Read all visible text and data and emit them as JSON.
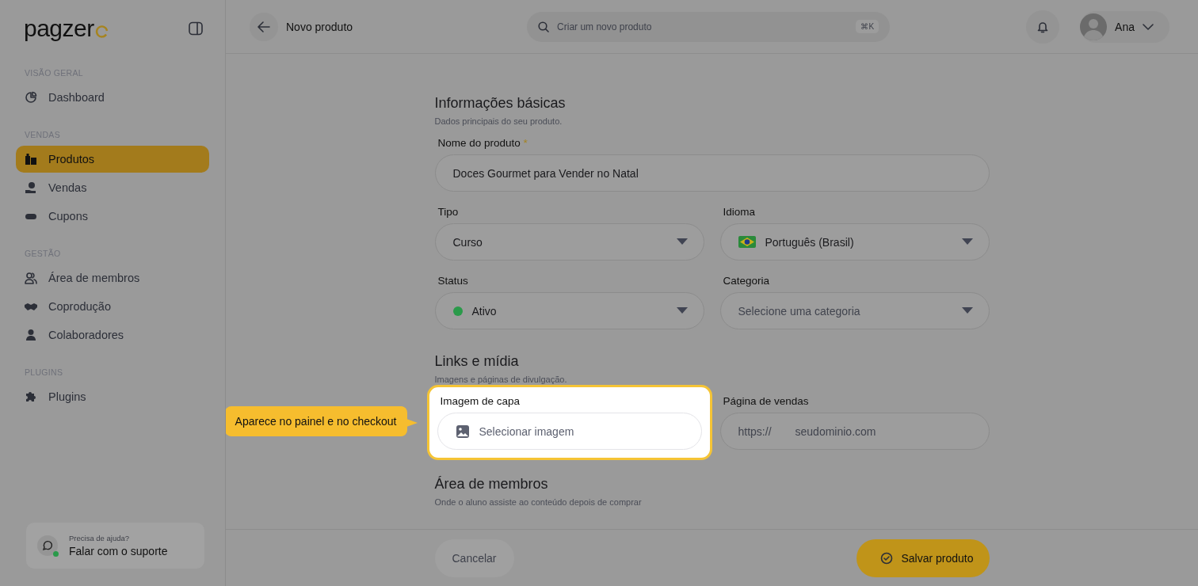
{
  "sidebar": {
    "logo": "pagzer",
    "sections": [
      {
        "heading": "VISÃO GERAL",
        "items": [
          {
            "label": "Dashboard",
            "selected": false
          }
        ]
      },
      {
        "heading": "VENDAS",
        "items": [
          {
            "label": "Produtos",
            "selected": true
          },
          {
            "label": "Vendas",
            "selected": false
          },
          {
            "label": "Cupons",
            "selected": false
          }
        ]
      },
      {
        "heading": "GESTÃO",
        "items": [
          {
            "label": "Área de membros",
            "selected": false
          },
          {
            "label": "Coprodução",
            "selected": false
          },
          {
            "label": "Colaboradores",
            "selected": false
          }
        ]
      },
      {
        "heading": "PLUGINS",
        "items": [
          {
            "label": "Plugins",
            "selected": false
          }
        ]
      }
    ],
    "help": {
      "caption": "Precisa de ajuda?",
      "link": "Falar com o suporte",
      "online": true
    }
  },
  "header": {
    "title": "Novo produto",
    "search": {
      "placeholder": "Criar um novo produto",
      "shortcut": "⌘K"
    },
    "user": "Ana"
  },
  "sections": [
    {
      "title": "Informações básicas",
      "subtitle": "Dados principais do seu produto.",
      "fields": [
        {
          "kind": "text",
          "label": "Nome do produto",
          "required_mark": "*",
          "value": "Doces Gourmet para Vender no Natal"
        },
        {
          "kind": "select",
          "label": "Tipo",
          "value": "Curso"
        },
        {
          "kind": "language",
          "label": "Idioma",
          "value": "Português (Brasil)"
        },
        {
          "kind": "select",
          "label": "Status",
          "value": "Ativo",
          "color": "#2a9a4a"
        },
        {
          "kind": "select",
          "label": "Categoria",
          "placeholder": "Selecione uma categoria"
        }
      ]
    },
    {
      "title": "Links e mídia",
      "subtitle": "Imagens e páginas de divulgação.",
      "fields": [
        {
          "kind": "image",
          "label": "Imagem de capa",
          "placeholder": "Selecionar imagem",
          "highlighted": true,
          "tooltip": "Aparece no painel e no checkout"
        },
        {
          "kind": "url",
          "label": "Página de vendas",
          "prefix": "https://",
          "placeholder": "seudominio.com"
        }
      ]
    },
    {
      "title": "Área de membros",
      "subtitle": "Onde o aluno assiste ao conteúdo depois de comprar"
    }
  ],
  "footer": {
    "cancel": "Cancelar",
    "save": "Salvar produto"
  }
}
